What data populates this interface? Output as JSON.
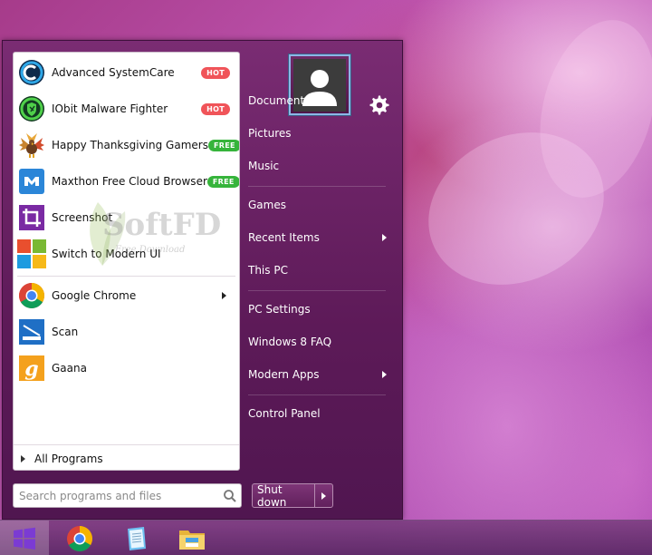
{
  "apps_top": [
    {
      "label": "Advanced SystemCare",
      "badge": "HOT",
      "icon": "advanced-systemcare-icon"
    },
    {
      "label": "IObit Malware Fighter",
      "badge": "HOT",
      "icon": "iobit-malware-fighter-icon"
    },
    {
      "label": "Happy Thanksgiving Gamers",
      "badge": "FREE",
      "icon": "turkey-icon"
    },
    {
      "label": "Maxthon Free Cloud Browser",
      "badge": "FREE",
      "icon": "maxthon-icon"
    },
    {
      "label": "Screenshot",
      "badge": "",
      "icon": "crop-icon"
    },
    {
      "label": "Switch to Modern UI",
      "badge": "",
      "icon": "windows-tiles-icon"
    }
  ],
  "apps_bottom": [
    {
      "label": "Google Chrome",
      "has_submenu": true,
      "icon": "chrome-icon"
    },
    {
      "label": "Scan",
      "has_submenu": false,
      "icon": "scan-icon"
    },
    {
      "label": "Gaana",
      "has_submenu": false,
      "icon": "gaana-icon"
    }
  ],
  "all_programs_label": "All Programs",
  "search": {
    "placeholder": "Search programs and files"
  },
  "right_menu": [
    {
      "label": "Documents",
      "has_submenu": false
    },
    {
      "label": "Pictures",
      "has_submenu": false
    },
    {
      "label": "Music",
      "has_submenu": false
    },
    {
      "label": "Games",
      "has_submenu": false
    },
    {
      "label": "Recent Items",
      "has_submenu": true
    },
    {
      "label": "This PC",
      "has_submenu": false
    },
    {
      "label": "PC Settings",
      "has_submenu": false
    },
    {
      "label": "Windows 8 FAQ",
      "has_submenu": false
    },
    {
      "label": "Modern Apps",
      "has_submenu": true
    },
    {
      "label": "Control Panel",
      "has_submenu": false
    }
  ],
  "shutdown_label": "Shut down",
  "watermark": {
    "text": "SoftFD",
    "sub": "Free Download"
  },
  "taskbar": {
    "icons": [
      "windows-start-icon",
      "chrome-icon",
      "notepad-icon",
      "file-explorer-icon"
    ]
  },
  "colors": {
    "hot": "#f05459",
    "free": "#36b43b",
    "menu_bg": "#5d1a58",
    "accent": "#8bb7e6"
  }
}
